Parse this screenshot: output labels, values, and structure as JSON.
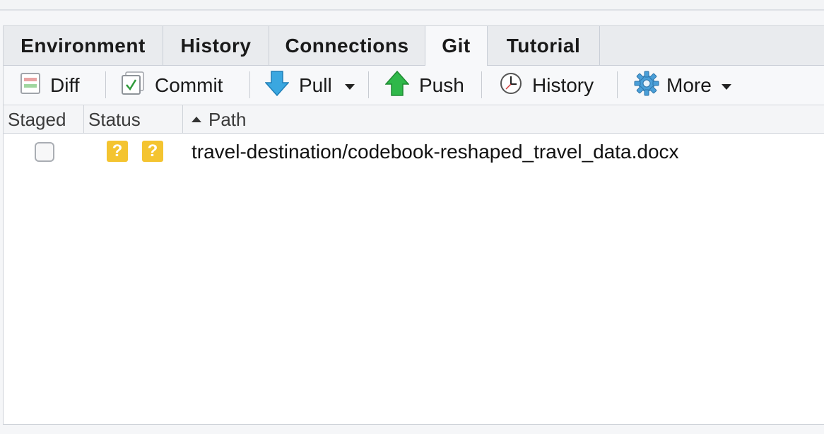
{
  "tabs": [
    {
      "label": "Environment",
      "active": false
    },
    {
      "label": "History",
      "active": false
    },
    {
      "label": "Connections",
      "active": false
    },
    {
      "label": "Git",
      "active": true
    },
    {
      "label": "Tutorial",
      "active": false
    }
  ],
  "toolbar": {
    "diff_label": "Diff",
    "commit_label": "Commit",
    "pull_label": "Pull",
    "push_label": "Push",
    "history_label": "History",
    "more_label": "More"
  },
  "columns": {
    "staged": "Staged",
    "status": "Status",
    "path": "Path",
    "path_sort": "ascending"
  },
  "files": [
    {
      "staged": false,
      "status_staged": "?",
      "status_unstaged": "?",
      "path": "travel-destination/codebook-reshaped_travel_data.docx"
    }
  ],
  "colors": {
    "status_untracked": "#f4c430",
    "pull_arrow": "#3aa7e0",
    "push_arrow": "#2fb84a",
    "gear": "#4a9fd8"
  },
  "icons": {
    "diff": "diff-icon",
    "commit": "commit-icon",
    "pull": "pull-arrow-icon",
    "push": "push-arrow-icon",
    "history": "clock-icon",
    "more": "gear-icon"
  }
}
